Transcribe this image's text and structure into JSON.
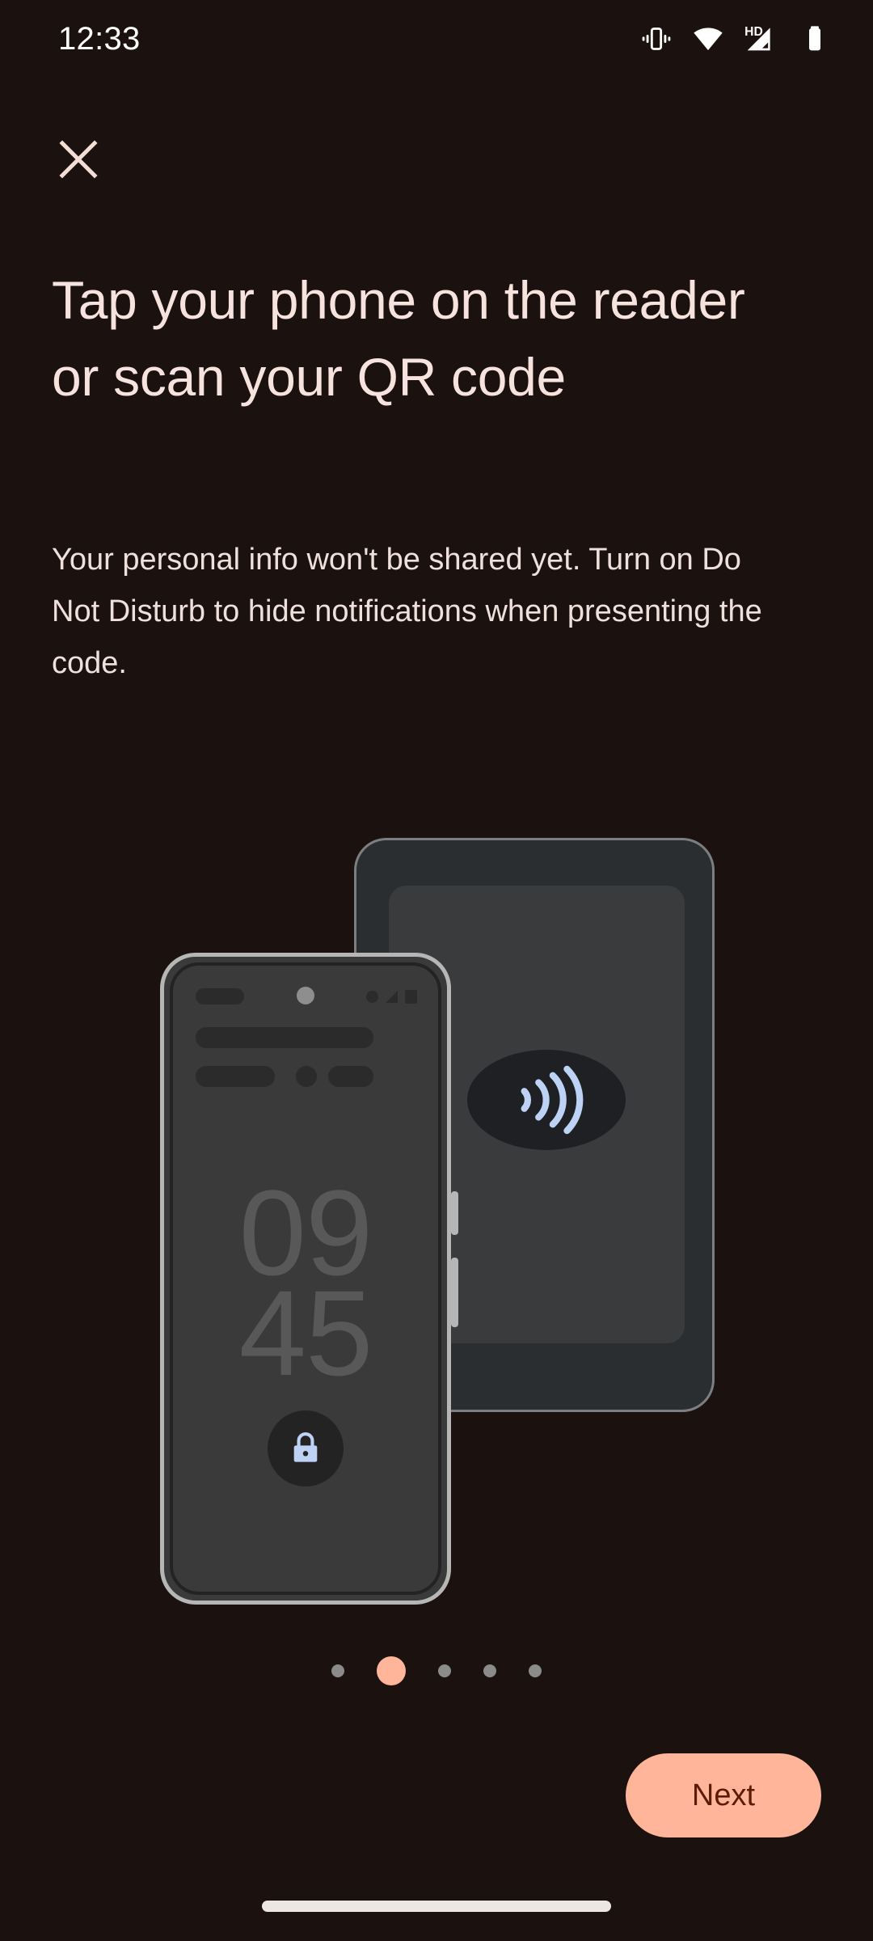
{
  "status_bar": {
    "time": "12:33",
    "icons": [
      "vibrate-icon",
      "wifi-icon",
      "hd-signal-icon",
      "battery-icon"
    ]
  },
  "header": {
    "close_label": "close-icon"
  },
  "main": {
    "headline": "Tap your phone on the reader or scan your QR code",
    "body": "Your personal info won't be shared yet. Turn on Do Not Disturb to hide notifications when presenting the code."
  },
  "illustration": {
    "reader_name": "payment-terminal",
    "nfc_symbol": "contactless-nfc-icon",
    "phone": {
      "lock_screen_hour": "09",
      "lock_screen_minute": "45",
      "lock_icon": "lock-icon"
    }
  },
  "pagination": {
    "total": 5,
    "active_index": 1
  },
  "footer": {
    "next_label": "Next"
  },
  "colors": {
    "background": "#1b110e",
    "headline_text": "#f6e3de",
    "body_text": "#efe0db",
    "accent": "#ffb59a",
    "button_text": "#5b1c06",
    "dot_inactive": "#8b8b8b",
    "nfc_blue": "#bdd2f5",
    "lock_blue": "#bdd2f5",
    "gesture_bar": "#ece6e5"
  }
}
